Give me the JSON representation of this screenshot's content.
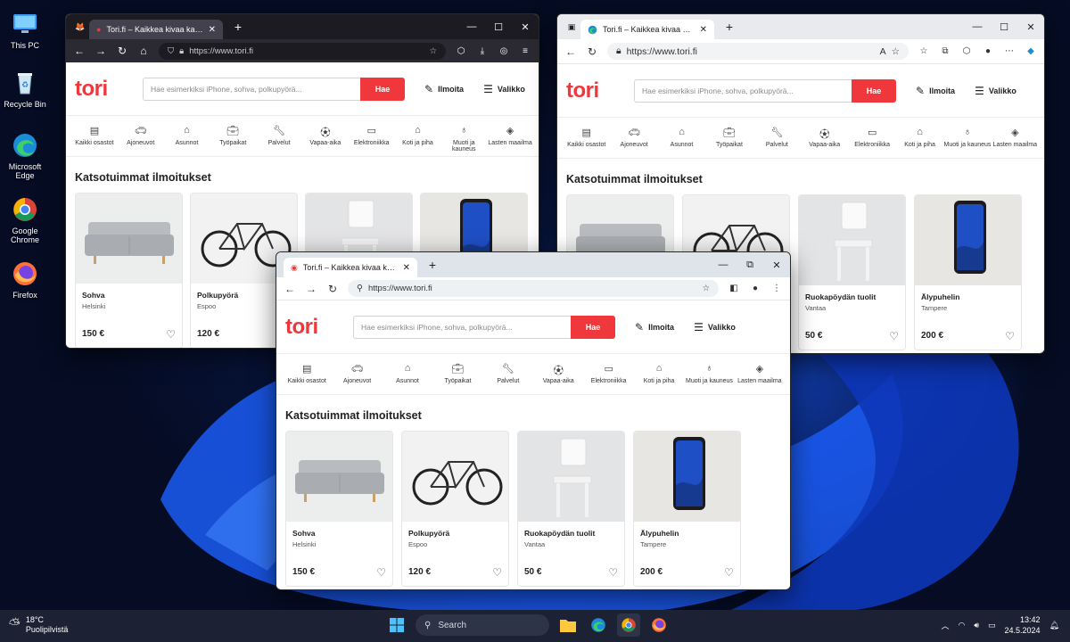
{
  "desktop": {
    "icons": [
      {
        "label": "This PC",
        "icon": "monitor-icon"
      },
      {
        "label": "Recycle Bin",
        "icon": "recycle-bin-icon"
      },
      {
        "label": "Microsoft Edge",
        "icon": "edge-icon"
      },
      {
        "label": "Google Chrome",
        "icon": "chrome-icon"
      },
      {
        "label": "Firefox",
        "icon": "firefox-icon"
      }
    ]
  },
  "tori": {
    "logo": "tori",
    "search_placeholder": "Hae esimerkiksi iPhone, sohva, polkupyörä...",
    "search_button": "Hae",
    "post_ad": "Ilmoita",
    "menu": "Valikko",
    "categories": [
      "Kaikki osastot",
      "Ajoneuvot",
      "Asunnot",
      "Työpaikat",
      "Palvelut",
      "Vapaa-aika",
      "Elektroniikka",
      "Koti ja piha",
      "Muoti ja kauneus",
      "Lasten maailma"
    ],
    "section_title": "Katsotuimmat ilmoitukset",
    "listings": [
      {
        "title": "Sohva",
        "location": "Helsinki",
        "price": "150 €"
      },
      {
        "title": "Polkupyörä",
        "location": "Espoo",
        "price": "120 €"
      },
      {
        "title": "Ruokapöydän tuolit",
        "location": "Vantaa",
        "price": "50 €"
      },
      {
        "title": "Älypuhelin",
        "location": "Tampere",
        "price": "200 €"
      }
    ]
  },
  "firefox": {
    "tab_title": "Tori.fi – Kaikkea kivaa kauppaa",
    "url": "https://www.tori.fi"
  },
  "edge": {
    "tab_title": "Tori.fi – Kaikkea kivaa kauppaa",
    "url": "https://www.tori.fi"
  },
  "chrome": {
    "tab_title": "Tori.fi – Kaikkea kivaa kauppaa",
    "url": "https://www.tori.fi"
  },
  "taskbar": {
    "temperature": "18°C",
    "weather": "Puolipilvistä",
    "search": "Search",
    "time": "13:42",
    "date": "24.5.2024"
  },
  "colors": {
    "brand": "#f0373c",
    "taskbar": "#1c2233"
  }
}
